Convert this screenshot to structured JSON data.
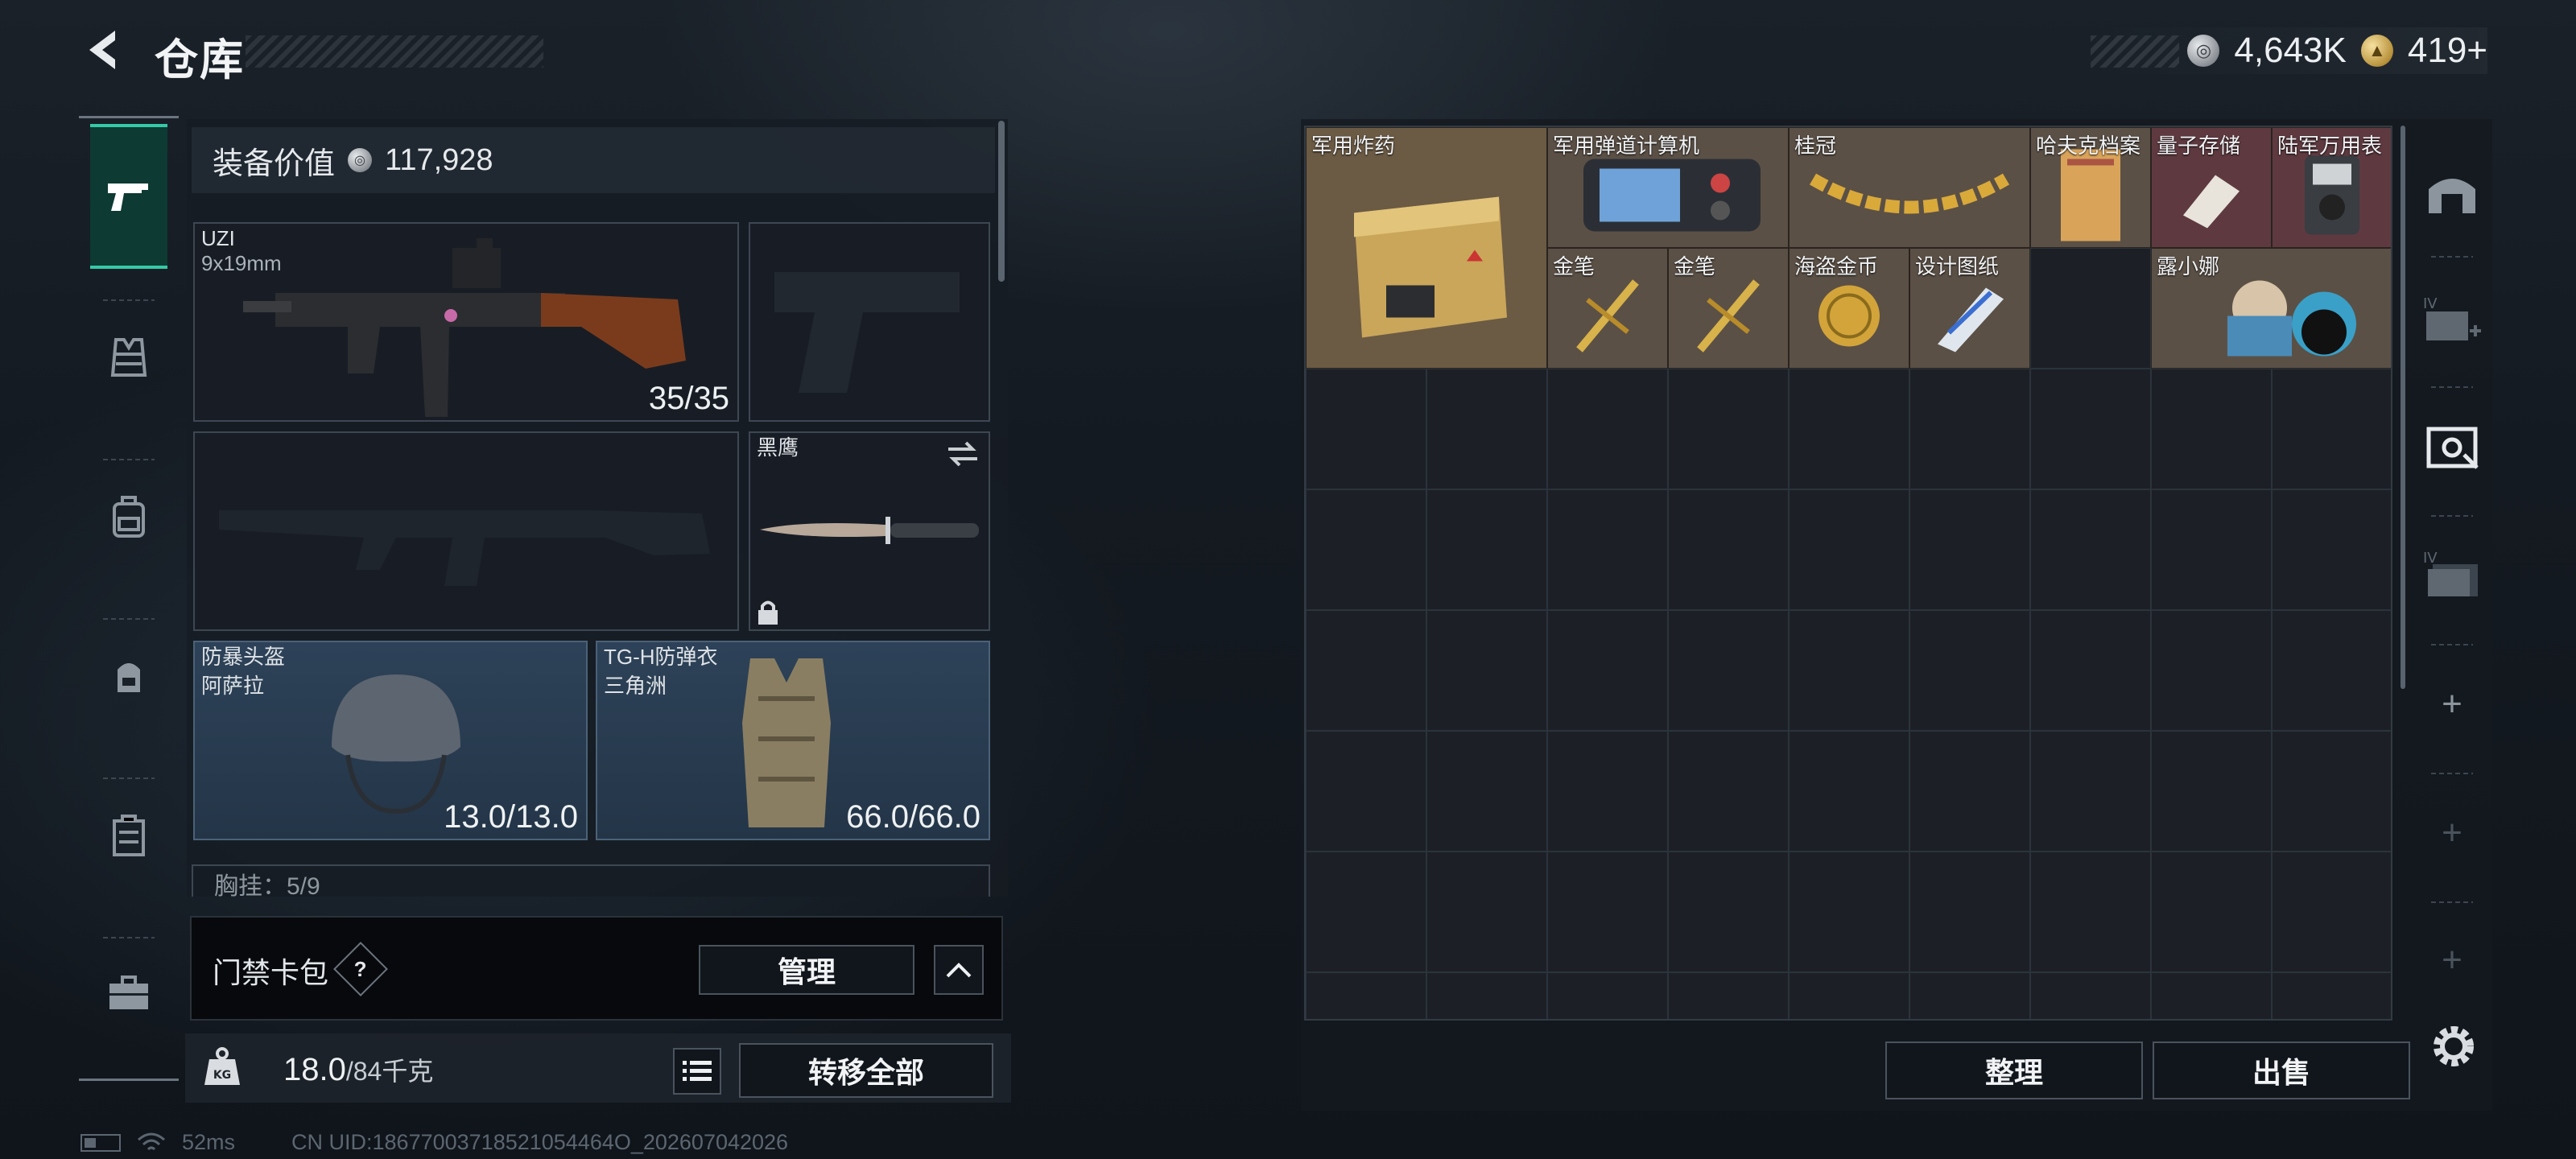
{
  "header": {
    "title": "仓库",
    "silver_amount": "4,643K",
    "gold_amount": "419+"
  },
  "sidebar": {
    "items": [
      "weapon-icon",
      "vest-icon",
      "backpack-icon",
      "pouch-icon",
      "case-icon",
      "toolbox-icon"
    ],
    "active": 0
  },
  "equipment": {
    "value_label": "装备价值",
    "value": "117,928",
    "primary_weapon": {
      "name": "UZI",
      "caliber": "9x19mm",
      "ammo": "35/35"
    },
    "melee": {
      "name": "黑鹰"
    },
    "helmet": {
      "name": "防暴头盔",
      "map": "阿萨拉",
      "durability": "13.0/13.0"
    },
    "armor": {
      "name": "TG-H防弹衣",
      "map": "三角洲",
      "durability": "66.0/66.0"
    },
    "chest_rig_partial": "胸挂：5/9"
  },
  "access": {
    "label": "门禁卡包",
    "help": "?",
    "manage_label": "管理"
  },
  "bottom": {
    "weight": "18.0",
    "weight_cap": "/84千克",
    "transfer_label": "转移全部"
  },
  "status": {
    "ping": "52ms",
    "uid": "CN UID:18677003718521054464O_202607042026"
  },
  "storage": {
    "items": [
      {
        "name": "军用炸药",
        "color": "#6b5a44"
      },
      {
        "name": "军用弹道计算机",
        "color": "#5b5046"
      },
      {
        "name": "桂冠",
        "color": "#5b5046"
      },
      {
        "name": "哈夫克档案",
        "color": "#5b5046"
      },
      {
        "name": "量子存储",
        "color": "#5e3a40"
      },
      {
        "name": "陆军万用表",
        "color": "#5e3a40"
      },
      {
        "name": "金笔",
        "color": "#5b5046"
      },
      {
        "name": "金笔",
        "color": "#5b5046"
      },
      {
        "name": "海盗金币",
        "color": "#5b5046"
      },
      {
        "name": "设计图纸",
        "color": "#5b5046"
      },
      {
        "name": "露小娜",
        "color": "#5b5046"
      }
    ],
    "sort_label": "整理",
    "sell_label": "出售"
  },
  "right_tabs": [
    "home-vault-icon",
    "add-case-icon",
    "safe-box-icon",
    "case-stack-icon",
    "plus-icon",
    "plus-icon",
    "plus-icon"
  ],
  "colors": {
    "accent": "#35c9a6",
    "panel": "#161c23"
  }
}
